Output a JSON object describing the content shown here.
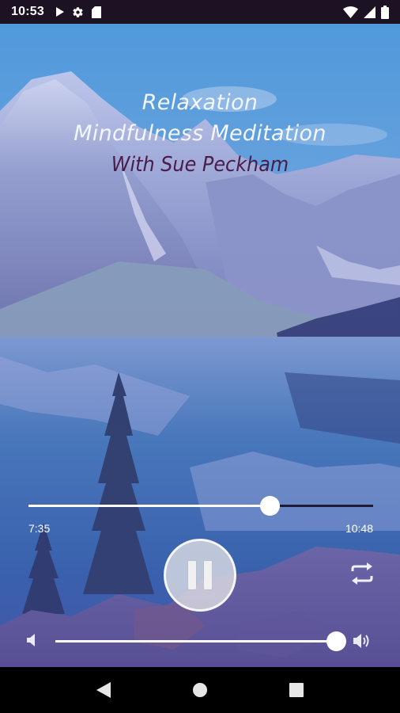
{
  "status_bar": {
    "time": "10:53",
    "icons": [
      "play-store-icon",
      "settings-icon",
      "sd-card-icon",
      "wifi-icon",
      "signal-icon",
      "battery-icon"
    ]
  },
  "titles": {
    "line1": "Relaxation",
    "line2": "Mindfulness Meditation",
    "line3": "With Sue Peckham"
  },
  "player": {
    "current_time": "7:35",
    "total_time": "10:48",
    "progress": 0.7,
    "volume": 1.0,
    "state": "playing"
  },
  "colors": {
    "accent_text": "#4a1c4a",
    "status_bar": "#1c1223",
    "title_text": "#f4f6ff"
  },
  "nav": {
    "icons": [
      "back-icon",
      "home-icon",
      "recents-icon"
    ]
  }
}
